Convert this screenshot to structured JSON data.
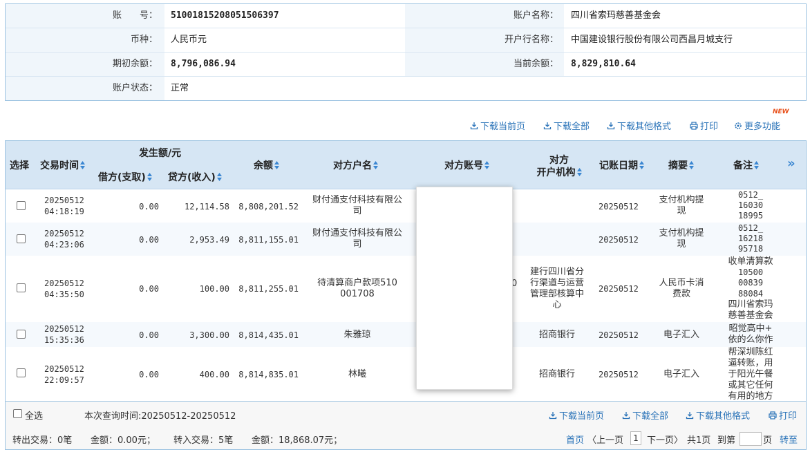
{
  "account": {
    "account_no_label": "账　　号：",
    "account_no": "51001815208051506397",
    "account_name_label": "账户名称：",
    "account_name": "四川省索玛慈善基金会",
    "currency_label": "币种：",
    "currency": "人民币元",
    "bank_label": "开户行名称：",
    "bank": "中国建设银行股份有限公司西昌月城支行",
    "opening_balance_label": "期初余额：",
    "opening_balance": "8,796,086.94",
    "current_balance_label": "当前余额：",
    "current_balance": "8,829,810.64",
    "status_label": "账户状态：",
    "status": "正常"
  },
  "toolbar": {
    "download_page": "下载当前页",
    "download_all": "下载全部",
    "download_other": "下载其他格式",
    "print": "打印",
    "more": "更多功能",
    "new_badge": "NEW"
  },
  "table": {
    "headers": {
      "select": "选择",
      "time": "交易时间",
      "amount_group": "发生额/元",
      "debit": "借方(支取)",
      "credit": "贷方(收入)",
      "balance": "余额",
      "counterparty_name": "对方户名",
      "counterparty_account": "对方账号",
      "counterparty_bank_line1": "对方",
      "counterparty_bank_line2": "开户机构",
      "post_date": "记账日期",
      "summary": "摘要",
      "remark": "备注",
      "more_cols": "»"
    },
    "rows": [
      {
        "date": "20250512",
        "time": "04:18:19",
        "debit": "0.00",
        "credit": "12,114.58",
        "balance": "8,808,201.52",
        "name1": "财付通支付科技有限公",
        "name2": "司",
        "bank": [],
        "post_date": "20250512",
        "summary1": "支付机构提",
        "summary2": "现",
        "remark": [
          "0512_",
          "16030",
          "18995"
        ]
      },
      {
        "date": "20250512",
        "time": "04:23:06",
        "debit": "0.00",
        "credit": "2,953.49",
        "balance": "8,811,155.01",
        "name1": "财付通支付科技有限公",
        "name2": "司",
        "bank": [],
        "post_date": "20250512",
        "summary1": "支付机构提",
        "summary2": "现",
        "remark": [
          "0512_",
          "16218",
          "95718"
        ]
      },
      {
        "date": "20250512",
        "time": "04:35:50",
        "debit": "0.00",
        "credit": "100.00",
        "balance": "8,811,255.01",
        "name1": "待清算商户款项510",
        "name2": "001708",
        "bank": [
          "建行四川省分",
          "行渠道与运营",
          "管理部核算中",
          "心"
        ],
        "post_date": "20250512",
        "summary1": "人民币卡消",
        "summary2": "费款",
        "remark": [
          "收单清算款",
          "10500",
          "00839",
          "88084",
          "四川省索玛",
          "慈善基金会"
        ]
      },
      {
        "date": "20250512",
        "time": "15:35:36",
        "debit": "0.00",
        "credit": "3,300.00",
        "balance": "8,814,435.01",
        "name1": "朱雅琼",
        "name2": "",
        "bank": [
          "招商银行"
        ],
        "post_date": "20250512",
        "summary1": "电子汇入",
        "summary2": "",
        "remark": [
          "昭觉高中+",
          "依的么你作"
        ]
      },
      {
        "date": "20250512",
        "time": "22:09:57",
        "debit": "0.00",
        "credit": "400.00",
        "balance": "8,814,835.01",
        "name1": "林曦",
        "name2": "",
        "bank": [
          "招商银行"
        ],
        "post_date": "20250512",
        "summary1": "电子汇入",
        "summary2": "",
        "remark": [
          "帮深圳陈红",
          "逼转账，用",
          "于阳光午餐",
          "或其它任何",
          "有用的地方"
        ]
      }
    ]
  },
  "footer": {
    "select_all": "全选",
    "query_time": "本次查询时间:20250512-20250512",
    "download_page": "下载当前页",
    "download_all": "下载全部",
    "download_other": "下载其他格式",
    "print": "打印",
    "out_count": "转出交易：0笔",
    "out_amount": "金额：0.00元；",
    "in_count": "转入交易：5笔",
    "in_amount": "金额：18,868.07元；",
    "first": "首页",
    "prev": "〈上一页",
    "current_page": "1",
    "next": "下一页〉",
    "total": "共1页",
    "goto": "到第",
    "page_unit": "页",
    "go": "转至"
  },
  "colors": {
    "link": "#2a73b8",
    "header_bg": "#d6e6f4",
    "border": "#9cc3e1",
    "sort_arrow": "#3a86d1",
    "new_badge": "#e8501a"
  }
}
